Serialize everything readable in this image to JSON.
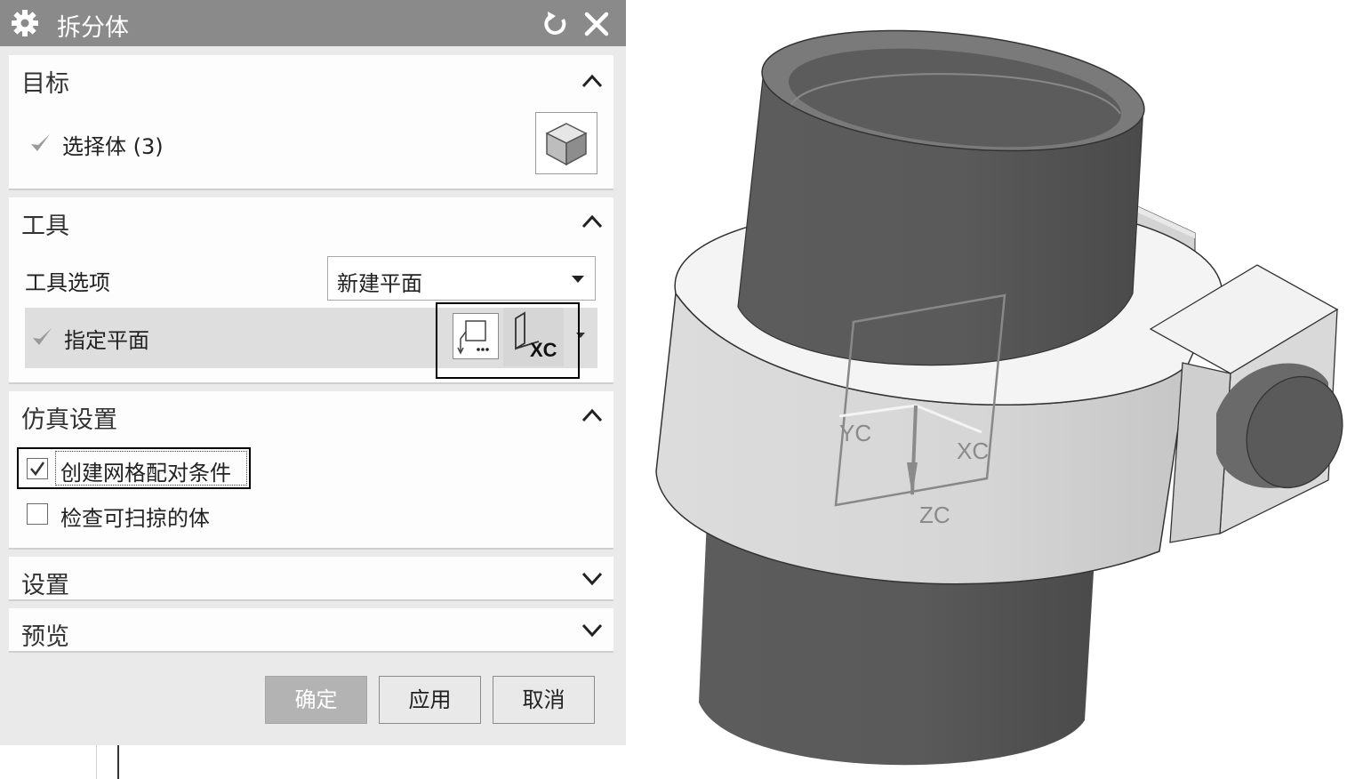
{
  "dialog": {
    "title": "拆分体",
    "sections": {
      "target": {
        "header": "目标",
        "select_body_label": "选择体 (3)"
      },
      "tool": {
        "header": "工具",
        "tool_option_label": "工具选项",
        "tool_option_value": "新建平面",
        "specify_plane_label": "指定平面"
      },
      "simulation": {
        "header": "仿真设置",
        "create_mesh_label": "创建网格配对条件",
        "create_mesh_checked": true,
        "check_sweep_label": "检查可扫掠的体",
        "check_sweep_checked": false
      },
      "settings": {
        "header": "设置"
      },
      "preview": {
        "header": "预览"
      }
    },
    "buttons": {
      "ok": "确定",
      "apply": "应用",
      "cancel": "取消"
    }
  },
  "viewport": {
    "axes": {
      "x_label": "XC",
      "y_label": "YC",
      "z_label": "ZC"
    }
  }
}
